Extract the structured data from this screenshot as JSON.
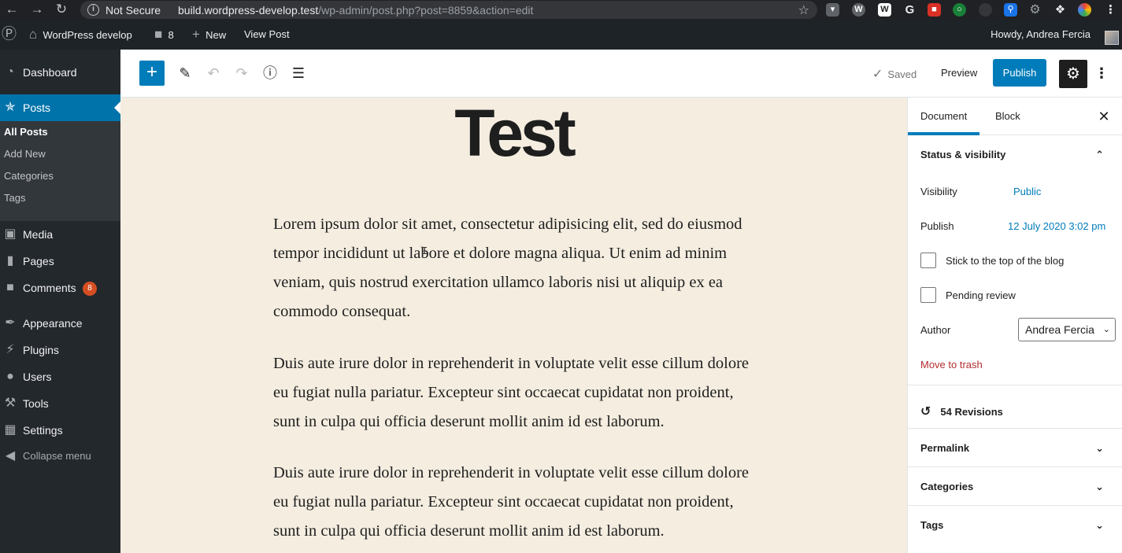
{
  "browser": {
    "security_label": "Not Secure",
    "url_host": "build.wordpress-develop.test",
    "url_path": "/wp-admin/post.php?post=8859&action=edit",
    "back_icon": "arrow-left-icon",
    "forward_icon": "arrow-right-icon",
    "reload_icon": "reload-icon"
  },
  "adminbar": {
    "site_name": "WordPress develop",
    "comments_count": "8",
    "new_label": "New",
    "view_post_label": "View Post",
    "howdy": "Howdy, Andrea Fercia"
  },
  "menu": {
    "items": [
      {
        "label": "Dashboard",
        "icon": "dashboard-icon"
      },
      {
        "label": "Posts",
        "icon": "pushpin-icon"
      },
      {
        "label": "Media",
        "icon": "media-icon"
      },
      {
        "label": "Pages",
        "icon": "pages-icon"
      },
      {
        "label": "Comments",
        "icon": "comment-icon"
      },
      {
        "label": "Appearance",
        "icon": "paintbrush-icon"
      },
      {
        "label": "Plugins",
        "icon": "plug-icon"
      },
      {
        "label": "Users",
        "icon": "user-icon"
      },
      {
        "label": "Tools",
        "icon": "wrench-icon"
      },
      {
        "label": "Settings",
        "icon": "settings-icon"
      }
    ],
    "submenu": [
      "All Posts",
      "Add New",
      "Categories",
      "Tags"
    ],
    "comments_badge": "8",
    "collapse_label": "Collapse menu"
  },
  "toolbar": {
    "saved_label": "Saved",
    "preview_label": "Preview",
    "publish_label": "Publish"
  },
  "post": {
    "title": "Test",
    "paragraphs": [
      "Lorem ipsum dolor sit amet, consectetur adipisicing elit, sed do eiusmod tempor incididunt ut labore et dolore magna aliqua. Ut enim ad minim veniam, quis nostrud exercitation ullamco laboris nisi ut aliquip ex ea commodo consequat.",
      "Duis aute irure dolor in reprehenderit in voluptate velit esse cillum dolore eu fugiat nulla pariatur. Excepteur sint occaecat cupidatat non proident, sunt in culpa qui officia deserunt mollit anim id est laborum.",
      "Duis aute irure dolor in reprehenderit in voluptate velit esse cillum dolore eu fugiat nulla pariatur. Excepteur sint occaecat cupidatat non proident, sunt in culpa qui officia deserunt mollit anim id est laborum."
    ]
  },
  "sidebar": {
    "tab_document": "Document",
    "tab_block": "Block",
    "status_heading": "Status & visibility",
    "visibility_label": "Visibility",
    "visibility_value": "Public",
    "publish_label": "Publish",
    "publish_value": "12 July 2020 3:02 pm",
    "sticky_label": "Stick to the top of the blog",
    "pending_label": "Pending review",
    "author_label": "Author",
    "author_value": "Andrea Fercia",
    "trash_label": "Move to trash",
    "revisions_label": "54 Revisions",
    "permalink_heading": "Permalink",
    "categories_heading": "Categories",
    "tags_heading": "Tags"
  },
  "colors": {
    "accent": "#007cba",
    "admin_dark": "#23282d",
    "menu_current": "#0073aa",
    "canvas_bg": "#f4ede0",
    "trash": "#b32d2e"
  }
}
